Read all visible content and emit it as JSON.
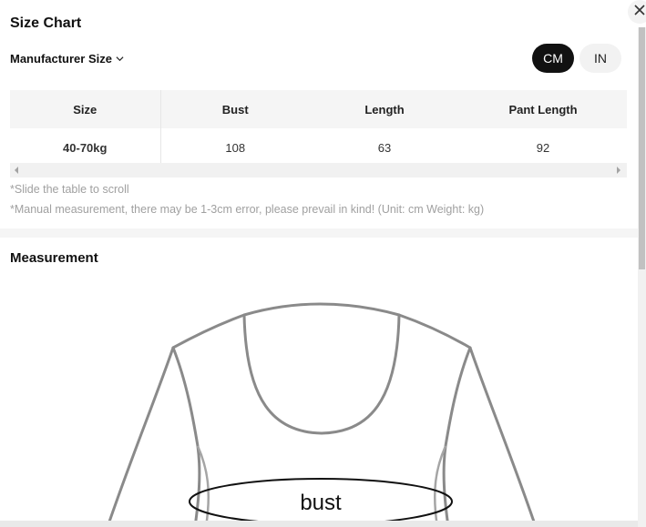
{
  "header": {
    "title": "Size Chart",
    "manufacturer_label": "Manufacturer Size",
    "units": {
      "cm": "CM",
      "in": "IN",
      "selected": "CM"
    }
  },
  "table": {
    "headers": [
      "Size",
      "Bust",
      "Length",
      "Pant Length"
    ],
    "rows": [
      [
        "40-70kg",
        "108",
        "63",
        "92"
      ]
    ]
  },
  "notes": {
    "scroll_hint": "*Slide the table to scroll",
    "measurement_note": "*Manual measurement, there may be 1-3cm error, please prevail in kind! (Unit: cm Weight: kg)"
  },
  "measurement": {
    "title": "Measurement",
    "diagram_label": "bust"
  },
  "icons": {
    "close": "close-icon",
    "dropdown": "chevron-down-icon"
  }
}
